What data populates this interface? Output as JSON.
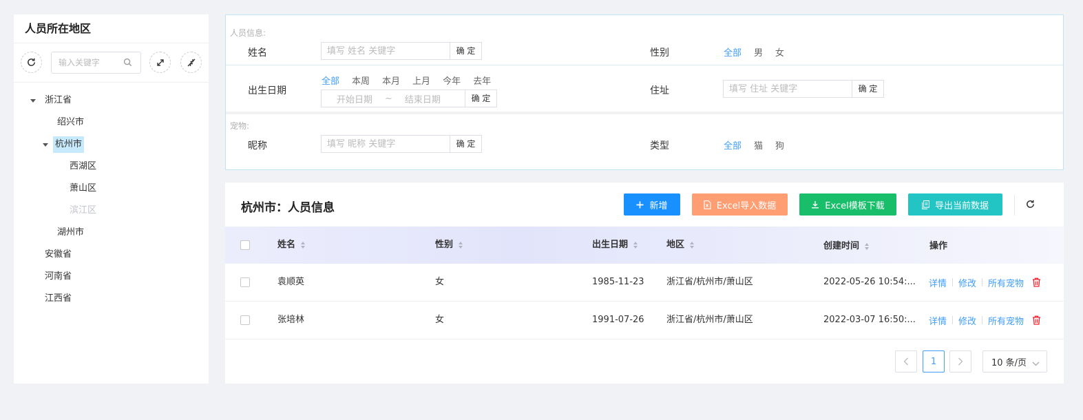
{
  "left": {
    "title": "人员所在地区",
    "search_placeholder": "输入关键字",
    "tree": [
      {
        "label": "浙江省"
      },
      {
        "label": "绍兴市"
      },
      {
        "label": "杭州市"
      },
      {
        "label": "西湖区"
      },
      {
        "label": "萧山区"
      },
      {
        "label": "滨江区"
      },
      {
        "label": "湖州市"
      },
      {
        "label": "安徽省"
      },
      {
        "label": "河南省"
      },
      {
        "label": "江西省"
      }
    ]
  },
  "filter": {
    "person_section": "人员信息:",
    "pet_section": "宠物:",
    "name_label": "姓名",
    "name_placeholder": "填写 姓名 关键字",
    "confirm": "确 定",
    "gender_label": "性别",
    "gender_options": [
      "全部",
      "男",
      "女"
    ],
    "birth_label": "出生日期",
    "birth_options": [
      "全部",
      "本周",
      "本月",
      "上月",
      "今年",
      "去年"
    ],
    "start_date": "开始日期",
    "range_sep": "~",
    "end_date": "结束日期",
    "address_label": "住址",
    "address_placeholder": "填写 住址 关键字",
    "nickname_label": "昵称",
    "nickname_placeholder": "填写 昵称 关键字",
    "type_label": "类型",
    "type_options": [
      "全部",
      "猫",
      "狗"
    ]
  },
  "main": {
    "title": "杭州市：人员信息",
    "buttons": {
      "add": "新增",
      "import": "Excel导入数据",
      "template": "Excel模板下载",
      "export": "导出当前数据"
    },
    "colors": {
      "add": "#1890ff",
      "import": "#ff9d73",
      "template": "#19be6b",
      "export": "#22c4c4",
      "link": "#409eff",
      "delete": "#f5222d"
    },
    "columns": [
      "姓名",
      "性别",
      "出生日期",
      "地区",
      "创建时间",
      "操作"
    ],
    "rows": [
      {
        "name": "袁顺英",
        "gender": "女",
        "birth": "1985-11-23",
        "region": "浙江省/杭州市/萧山区",
        "created": "2022-05-26 10:54:..."
      },
      {
        "name": "张培林",
        "gender": "女",
        "birth": "1991-07-26",
        "region": "浙江省/杭州市/萧山区",
        "created": "2022-03-07 16:50:..."
      }
    ],
    "row_actions": [
      "详情",
      "修改",
      "所有宠物"
    ],
    "pager": {
      "page": "1",
      "page_size": "10 条/页"
    }
  }
}
